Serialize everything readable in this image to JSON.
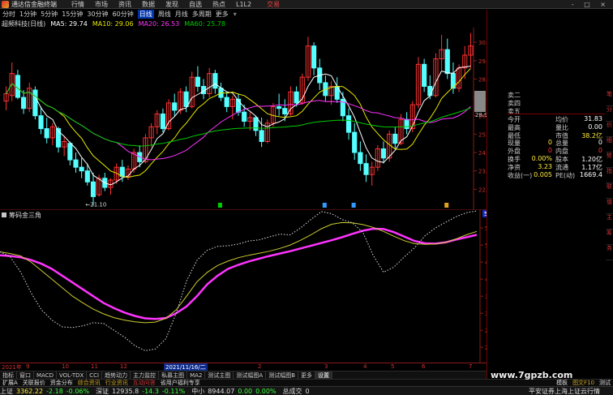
{
  "menu": {
    "app_title": "通达信金融终端",
    "items": [
      "行情",
      "市场",
      "资讯",
      "数据",
      "发现",
      "自选",
      "热点",
      "L1L2"
    ],
    "trade": "交易",
    "window_controls": "- □ ×"
  },
  "periods": {
    "items": [
      "分时",
      "1分钟",
      "5分钟",
      "15分钟",
      "30分钟",
      "60分钟",
      "日线",
      "周线",
      "月线",
      "多周期",
      "更多"
    ],
    "active_index": 6
  },
  "stock_label": "超频科技(日线)",
  "ma": [
    {
      "label": "MA5: 29.74",
      "color": "#ffffff"
    },
    {
      "label": "MA10: 29.06",
      "color": "#e6e600"
    },
    {
      "label": "MA20: 26.53",
      "color": "#ff33ff"
    },
    {
      "label": "MA60: 25.78",
      "color": "#00cc00"
    }
  ],
  "main_axis": {
    "ticks": [
      "30.00",
      "29.00",
      "28.00",
      "27.00",
      "26.00",
      "25.00",
      "24.00",
      "23.00",
      "22.00"
    ],
    "low_marker": "21.10",
    "current_tag": "28.9",
    "ylim": [
      21,
      30.8
    ]
  },
  "sub_indicator": {
    "name": "筹码金三角",
    "ticks": [
      "55.00",
      "50.00",
      "45.00",
      "40.00",
      "35.00",
      "30.00",
      "25.00",
      "20.00"
    ],
    "current_tag": "59.10",
    "ylim": [
      16,
      60.5
    ]
  },
  "dates": [
    "2021年",
    "9",
    "10",
    "11",
    "12",
    "2021/11/16/二",
    "2",
    "3",
    "4",
    "5",
    "6",
    "7"
  ],
  "ind_tabs": [
    "指标",
    "窗口",
    "MACD",
    "VOL-TDX",
    "CCI",
    "趋势动力",
    "主力监控",
    "私募主图",
    "MA2",
    "测试主图",
    "测试幅图A",
    "测试幅图B",
    "更多",
    "设置"
  ],
  "info_tabs": [
    "扩展A",
    "关联报价",
    "资金分布",
    "综合资讯",
    "行业资讯",
    "互动问答",
    "省用户福利专享"
  ],
  "info_right": [
    "模板",
    "图文F10",
    "测试"
  ],
  "status": [
    {
      "label": "上证",
      "value": "3362.22",
      "change": "-2.18",
      "pct": "-0.06%"
    },
    {
      "label": "深证",
      "value": "12935.8",
      "change": "-14.3",
      "pct": "-0.11%"
    },
    {
      "label": "中小",
      "value": "8944.07",
      "change": "0.00",
      "pct": "0.00%"
    },
    {
      "label": "总成交",
      "value": "0",
      "change": "",
      "pct": ""
    }
  ],
  "status_right": "平安证券上海上证云行情",
  "quote_panel": {
    "sell_labels": [
      "卖二",
      "卖四",
      "卖五"
    ],
    "rows": [
      {
        "l1": "今开",
        "v1": "",
        "l2": "均价",
        "v2": "31.83"
      },
      {
        "l1": "最高",
        "v1": "",
        "l2": "量比",
        "v2": "0.00"
      },
      {
        "l1": "最低",
        "v1": "",
        "l2": "市值",
        "v2": "38.2亿"
      },
      {
        "l1": "现量",
        "v1": "0",
        "l2": "总量",
        "v2": "0"
      },
      {
        "l1": "外盘",
        "v1": "0",
        "l2": "内盘",
        "v2": "0"
      },
      {
        "l1": "换手",
        "v1": "0.00%",
        "l2": "股本",
        "v2": "1.20亿"
      },
      {
        "l1": "净资",
        "v1": "3.23",
        "l2": "流通",
        "v2": "1.17亿"
      },
      {
        "l1": "收益(一)",
        "v1": "0.005",
        "l2": "PE(动)",
        "v2": "1669.4"
      }
    ]
  },
  "side_tabs": [
    "笔",
    "分",
    "价",
    "细",
    "势",
    "指",
    "联",
    "值",
    "主",
    "筹",
    "务"
  ],
  "watermark": "www.7gpzb.com",
  "chart_data": [
    {
      "type": "candlestick",
      "title": "超频科技(日线)",
      "ylim": [
        21,
        30.8
      ],
      "ohlc": [
        [
          26.8,
          27.6,
          26.3,
          27.2
        ],
        [
          27.1,
          28.9,
          26.8,
          28.3
        ],
        [
          28.2,
          28.5,
          26.9,
          27.0
        ],
        [
          27.0,
          27.4,
          26.1,
          26.4
        ],
        [
          26.4,
          27.8,
          26.2,
          27.5
        ],
        [
          27.4,
          27.6,
          25.8,
          26.0
        ],
        [
          26.0,
          26.5,
          25.0,
          25.3
        ],
        [
          25.3,
          25.9,
          24.5,
          24.8
        ],
        [
          24.8,
          25.6,
          24.4,
          25.4
        ],
        [
          25.3,
          25.4,
          24.0,
          24.3
        ],
        [
          24.3,
          24.9,
          23.8,
          24.6
        ],
        [
          24.5,
          24.6,
          23.3,
          23.6
        ],
        [
          23.6,
          24.0,
          22.9,
          23.2
        ],
        [
          23.2,
          23.7,
          22.6,
          23.0
        ],
        [
          23.0,
          23.4,
          22.2,
          22.4
        ],
        [
          22.4,
          22.9,
          21.1,
          21.6
        ],
        [
          21.7,
          22.8,
          21.6,
          22.6
        ],
        [
          22.6,
          22.9,
          21.9,
          22.1
        ],
        [
          22.1,
          22.6,
          21.7,
          22.5
        ],
        [
          22.5,
          23.4,
          22.3,
          23.2
        ],
        [
          23.2,
          23.6,
          22.4,
          22.7
        ],
        [
          22.7,
          23.3,
          22.5,
          23.1
        ],
        [
          23.1,
          24.2,
          22.9,
          24.0
        ],
        [
          24.0,
          24.4,
          23.2,
          23.5
        ],
        [
          23.5,
          25.0,
          23.4,
          24.8
        ],
        [
          24.8,
          25.6,
          24.3,
          25.4
        ],
        [
          25.4,
          26.3,
          25.0,
          26.1
        ],
        [
          26.1,
          26.4,
          25.1,
          25.3
        ],
        [
          25.3,
          26.9,
          25.2,
          26.7
        ],
        [
          26.7,
          27.2,
          26.0,
          26.3
        ],
        [
          26.3,
          27.5,
          26.1,
          27.3
        ],
        [
          27.3,
          27.6,
          26.2,
          26.5
        ],
        [
          26.5,
          28.4,
          26.4,
          28.1
        ],
        [
          28.1,
          28.7,
          27.3,
          27.6
        ],
        [
          27.6,
          28.0,
          26.9,
          27.2
        ],
        [
          27.2,
          28.6,
          27.0,
          28.3
        ],
        [
          28.3,
          28.5,
          27.2,
          27.5
        ],
        [
          27.5,
          27.8,
          26.8,
          27.0
        ],
        [
          27.0,
          27.3,
          26.2,
          26.5
        ],
        [
          26.5,
          27.1,
          25.8,
          26.9
        ],
        [
          26.9,
          27.2,
          26.0,
          26.2
        ],
        [
          26.2,
          26.6,
          25.4,
          25.7
        ],
        [
          25.7,
          26.2,
          25.2,
          25.9
        ],
        [
          25.9,
          26.0,
          24.9,
          25.2
        ],
        [
          25.2,
          25.9,
          24.3,
          24.6
        ],
        [
          24.6,
          25.8,
          24.5,
          25.6
        ],
        [
          25.6,
          26.7,
          25.4,
          26.5
        ],
        [
          26.5,
          27.2,
          26.0,
          26.4
        ],
        [
          26.4,
          26.9,
          25.7,
          26.1
        ],
        [
          26.1,
          27.6,
          26.0,
          27.3
        ],
        [
          27.3,
          27.6,
          26.5,
          26.7
        ],
        [
          26.7,
          28.3,
          26.6,
          28.1
        ],
        [
          28.1,
          30.3,
          27.9,
          29.8
        ],
        [
          29.8,
          30.0,
          28.2,
          28.6
        ],
        [
          28.6,
          29.1,
          27.4,
          27.8
        ],
        [
          27.8,
          28.2,
          26.8,
          27.1
        ],
        [
          27.1,
          27.9,
          26.6,
          27.6
        ],
        [
          27.6,
          28.1,
          26.7,
          26.9
        ],
        [
          26.9,
          27.3,
          25.7,
          26.0
        ],
        [
          26.0,
          26.4,
          24.7,
          25.1
        ],
        [
          25.1,
          25.6,
          23.6,
          24.0
        ],
        [
          24.0,
          24.6,
          23.0,
          23.4
        ],
        [
          23.4,
          23.9,
          22.4,
          22.8
        ],
        [
          22.8,
          23.5,
          22.2,
          23.2
        ],
        [
          23.2,
          24.4,
          23.0,
          24.2
        ],
        [
          24.2,
          24.6,
          23.4,
          23.7
        ],
        [
          23.7,
          25.2,
          23.5,
          25.0
        ],
        [
          25.0,
          25.4,
          24.2,
          24.5
        ],
        [
          24.5,
          26.1,
          24.4,
          25.8
        ],
        [
          25.8,
          26.2,
          25.0,
          25.3
        ],
        [
          25.3,
          26.8,
          25.1,
          26.6
        ],
        [
          26.6,
          29.2,
          26.4,
          28.8
        ],
        [
          28.8,
          29.1,
          27.3,
          27.6
        ],
        [
          27.6,
          28.2,
          26.9,
          27.1
        ],
        [
          27.1,
          29.4,
          27.0,
          29.1
        ],
        [
          29.1,
          30.4,
          28.5,
          29.6
        ],
        [
          29.6,
          30.2,
          28.0,
          28.3
        ],
        [
          28.3,
          28.9,
          27.2,
          27.5
        ],
        [
          27.5,
          28.8,
          27.3,
          28.6
        ],
        [
          28.6,
          29.8,
          28.0,
          29.3
        ],
        [
          29.3,
          30.5,
          28.6,
          29.8
        ]
      ]
    },
    {
      "type": "line",
      "title": "筹码金三角",
      "ylim": [
        16,
        60.5
      ],
      "series": [
        {
          "name": "",
          "color": "#ff33ff",
          "values": [
            47,
            46.8,
            46.4,
            45.6,
            44.5,
            43,
            41,
            39,
            37,
            35,
            33,
            31.5,
            30.2,
            29.2,
            28.5,
            28.3,
            28.6,
            30,
            32,
            35,
            38.5,
            41,
            43,
            44.2,
            45.2,
            46,
            46.8,
            47.5,
            48.2,
            49,
            49.8,
            50.6,
            51.4,
            52.3,
            53.3,
            54.2,
            54.8,
            54.7,
            53.8,
            52.5,
            51.2,
            50.5,
            50.4,
            50.8,
            51.6,
            52.3,
            53
          ]
        },
        {
          "name": "",
          "color": "#cccc33",
          "values": [
            48,
            47.5,
            46.8,
            45,
            42.5,
            40,
            37.5,
            35,
            33,
            31.2,
            29.8,
            28.7,
            28,
            27.5,
            27.2,
            27.4,
            28.5,
            31,
            35,
            39.2,
            42,
            44,
            45.3,
            46.3,
            47,
            47.6,
            48.2,
            49,
            50,
            51.4,
            53,
            54.8,
            56.1,
            56.6,
            56.5,
            56,
            55.2,
            54,
            52.6,
            51.3,
            50.4,
            50.2,
            50.3,
            50.8,
            51.8,
            53,
            54
          ]
        },
        {
          "name": "",
          "color": "#dddddd",
          "values": [
            48,
            46.5,
            42,
            36,
            31,
            28,
            26,
            25.8,
            26.3,
            27.2,
            27,
            25,
            23,
            20.5,
            19,
            19.5,
            22.5,
            30,
            39.5,
            45.5,
            48.5,
            49.6,
            49.8,
            50.3,
            51.2,
            51.5,
            52.4,
            53.2,
            53,
            55,
            57.5,
            59.8,
            59.2,
            57.5,
            56.5,
            53.8,
            47,
            42,
            43.5,
            46.5,
            49.2,
            52.7,
            55,
            56.7,
            58.3,
            59.5,
            60
          ]
        }
      ]
    }
  ]
}
